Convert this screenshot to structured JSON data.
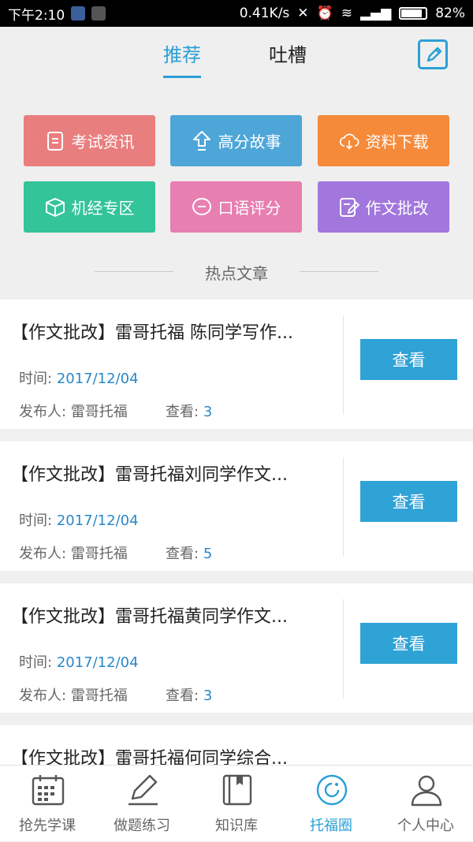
{
  "status_bar": {
    "time": "下午2:10",
    "speed": "0.41K/s",
    "battery": "82%"
  },
  "tabs": {
    "recommend": "推荐",
    "rant": "吐槽"
  },
  "categories": [
    {
      "label": "考试资讯",
      "color": "#e97e7e",
      "icon": "document-icon"
    },
    {
      "label": "高分故事",
      "color": "#4ea6d8",
      "icon": "upload-arrow-icon"
    },
    {
      "label": "资料下载",
      "color": "#f58a3a",
      "icon": "cloud-download-icon"
    },
    {
      "label": "机经专区",
      "color": "#33c49a",
      "icon": "cube-icon"
    },
    {
      "label": "口语评分",
      "color": "#e77fb0",
      "icon": "speech-bubble-icon"
    },
    {
      "label": "作文批改",
      "color": "#a176dd",
      "icon": "edit-note-icon"
    }
  ],
  "section_title": "热点文章",
  "articles": [
    {
      "title": "【作文批改】雷哥托福 陈同学写作...",
      "time_label": "时间:",
      "time": "2017/12/04",
      "author_label": "发布人:",
      "author": "雷哥托福",
      "views_label": "查看:",
      "views": "3",
      "button": "查看"
    },
    {
      "title": "【作文批改】雷哥托福刘同学作文...",
      "time_label": "时间:",
      "time": "2017/12/04",
      "author_label": "发布人:",
      "author": "雷哥托福",
      "views_label": "查看:",
      "views": "5",
      "button": "查看"
    },
    {
      "title": "【作文批改】雷哥托福黄同学作文...",
      "time_label": "时间:",
      "time": "2017/12/04",
      "author_label": "发布人:",
      "author": "雷哥托福",
      "views_label": "查看:",
      "views": "3",
      "button": "查看"
    },
    {
      "title": "【作文批改】雷哥托福何同学综合...",
      "time_label": "",
      "time": "",
      "author_label": "",
      "author": "",
      "views_label": "",
      "views": "",
      "button": ""
    }
  ],
  "bottom_nav": [
    {
      "label": "抢先学课",
      "icon": "calendar-icon"
    },
    {
      "label": "做题练习",
      "icon": "pencil-icon"
    },
    {
      "label": "知识库",
      "icon": "book-icon"
    },
    {
      "label": "托福圈",
      "icon": "circle-refresh-icon",
      "active": true
    },
    {
      "label": "个人中心",
      "icon": "person-icon"
    }
  ]
}
